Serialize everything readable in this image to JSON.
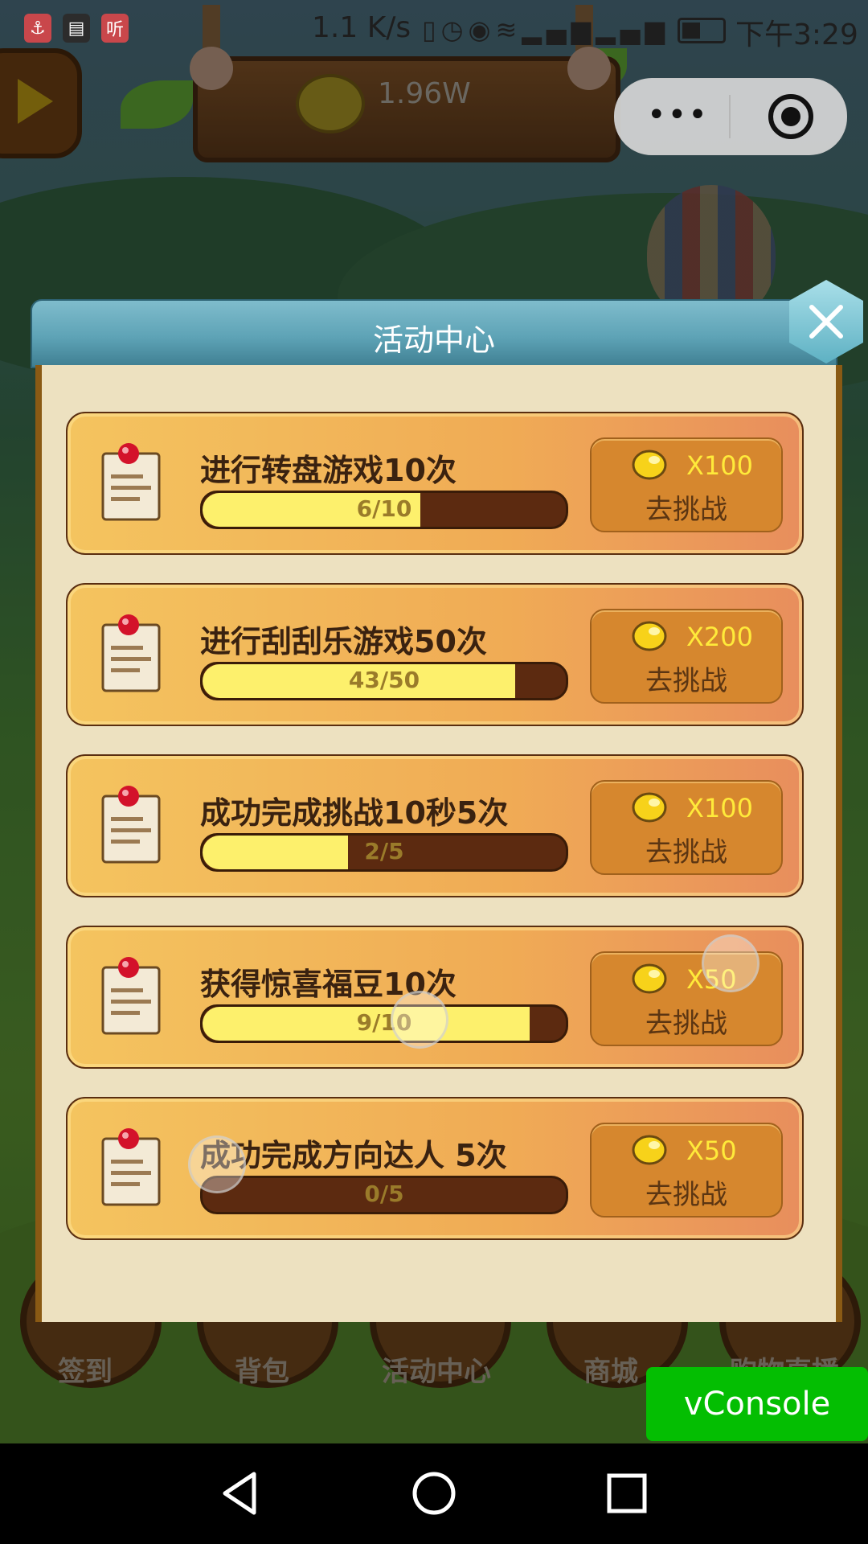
{
  "status_bar": {
    "left_icons": [
      "app-icon",
      "film-icon",
      "ting-icon"
    ],
    "ting_label": "听",
    "net_speed": "1.1 K/s",
    "time": "下午3:29"
  },
  "hud": {
    "coin_amount": "1.96W"
  },
  "capsule": {
    "more_label": "•••"
  },
  "bottom_nav": {
    "items": [
      {
        "label": "签到"
      },
      {
        "label": "背包"
      },
      {
        "label": "活动中心"
      },
      {
        "label": "商城"
      },
      {
        "label": "购物直播"
      }
    ]
  },
  "modal": {
    "title": "活动中心",
    "tasks": [
      {
        "title": "进行转盘游戏10次",
        "progress_text": "6/10",
        "progress": 0.6,
        "reward": "X100",
        "button": "去挑战"
      },
      {
        "title": "进行刮刮乐游戏50次",
        "progress_text": "43/50",
        "progress": 0.86,
        "reward": "X200",
        "button": "去挑战"
      },
      {
        "title": "成功完成挑战10秒5次",
        "progress_text": "2/5",
        "progress": 0.4,
        "reward": "X100",
        "button": "去挑战"
      },
      {
        "title": "获得惊喜福豆10次",
        "progress_text": "9/10",
        "progress": 0.9,
        "reward": "X50",
        "button": "去挑战"
      },
      {
        "title": "成功完成方向达人 5次",
        "progress_text": "0/5",
        "progress": 0,
        "reward": "X50",
        "button": "去挑战"
      }
    ]
  },
  "vconsole": {
    "label": "vConsole"
  },
  "colors": {
    "header": "#5ea3b6",
    "row": "#f0ab55",
    "progress_fill": "#fdf06c",
    "reward_text": "#ffea3a",
    "vconsole": "#04be02"
  }
}
